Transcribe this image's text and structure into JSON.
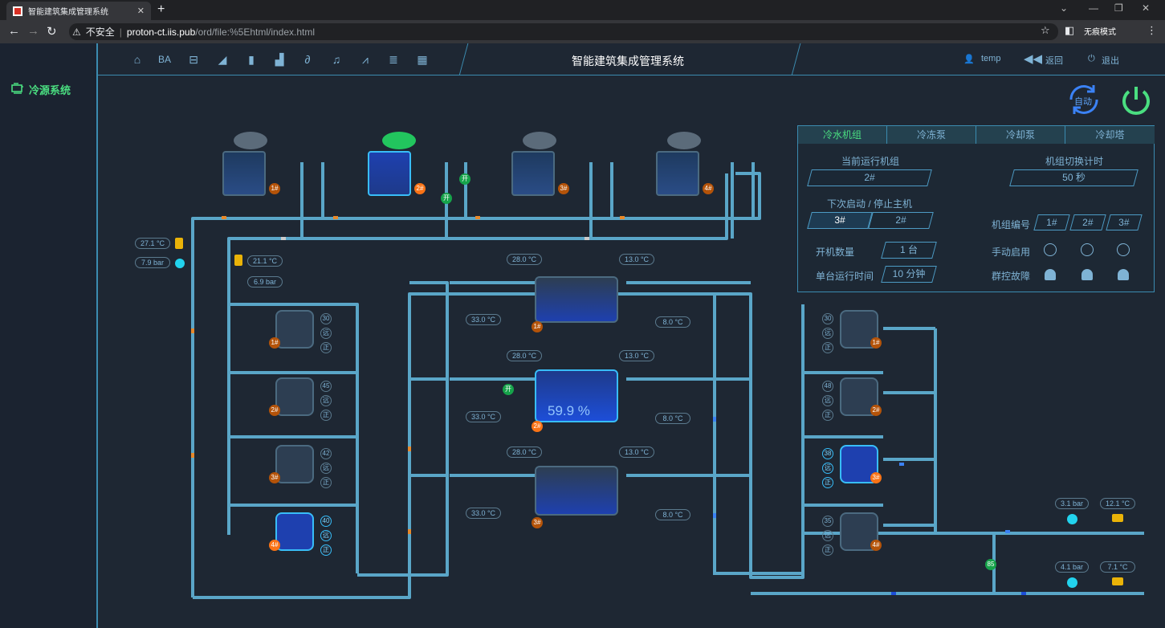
{
  "browser": {
    "tab_title": "智能建筑集成管理系统",
    "new_tab": "+",
    "security": "不安全",
    "url_host": "proton-ct.iis.pub",
    "url_path": "/ord/file:%5Ehtml/index.html",
    "incognito": "无痕模式"
  },
  "sidebar": {
    "items": [
      {
        "label": "冷源系统",
        "icon": "chiller-icon"
      }
    ]
  },
  "header": {
    "title": "智能建筑集成管理系统",
    "user": "temp",
    "back": "返回",
    "logout": "退出",
    "nav_icons": [
      "home-icon",
      "ba-icon",
      "chiller-icon",
      "dish-icon",
      "panel-icon",
      "chart-bar-icon",
      "clip-icon",
      "bell-icon",
      "trend-icon",
      "doc-icon",
      "grid-icon"
    ]
  },
  "controls": {
    "auto": "自动"
  },
  "panel": {
    "tabs": [
      "冷水机组",
      "冷冻泵",
      "冷却泵",
      "冷却塔"
    ],
    "current_unit_label": "当前运行机组",
    "current_unit": "2#",
    "switch_timer_label": "机组切换计时",
    "switch_timer": "50 秒",
    "next_label": "下次启动 / 停止主机",
    "next_start": "3#",
    "next_stop": "2#",
    "unit_no_label": "机组编号",
    "units": [
      "1#",
      "2#",
      "3#"
    ],
    "count_label": "开机数量",
    "count": "1 台",
    "manual_label": "手动启用",
    "runtime_label": "单台运行时间",
    "runtime": "10 分钟",
    "fault_label": "群控故障"
  },
  "towers": [
    {
      "id": "1#",
      "active": false
    },
    {
      "id": "2#",
      "active": true,
      "valve1": "开",
      "valve2": "开"
    },
    {
      "id": "3#",
      "active": false
    },
    {
      "id": "4#",
      "active": false
    }
  ],
  "sensors": {
    "left_temp": "27.1 °C",
    "left_press": "7.9 bar",
    "left2_temp": "21.1 °C",
    "left2_press": "6.9 bar",
    "right1_press": "3.1 bar",
    "right1_temp": "12.1 °C",
    "right2_press": "4.1 bar",
    "right2_temp": "7.1 °C"
  },
  "chillers": [
    {
      "id": "1#",
      "t_in_left": "28.0 °C",
      "t_out_left": "33.0 °C",
      "t_in_right": "13.0 °C",
      "t_out_right": "8.0 °C",
      "active": false
    },
    {
      "id": "2#",
      "t_in_left": "28.0 °C",
      "t_out_left": "33.0 °C",
      "t_in_right": "13.0 °C",
      "t_out_right": "8.0 °C",
      "active": true,
      "load": "59.9 %",
      "valve": "开"
    },
    {
      "id": "3#",
      "t_in_left": "28.0 °C",
      "t_out_left": "33.0 °C",
      "t_in_right": "13.0 °C",
      "t_out_right": "8.0 °C",
      "active": false
    }
  ],
  "left_pumps": [
    {
      "id": "1#",
      "freq": "30",
      "mode": "远",
      "state": "正",
      "active": false
    },
    {
      "id": "2#",
      "freq": "45",
      "mode": "远",
      "state": "正",
      "active": false
    },
    {
      "id": "3#",
      "freq": "42",
      "mode": "远",
      "state": "正",
      "active": false
    },
    {
      "id": "4#",
      "freq": "40",
      "mode": "远",
      "state": "正",
      "active": true
    }
  ],
  "right_pumps": [
    {
      "id": "1#",
      "freq": "30",
      "mode": "远",
      "state": "正",
      "active": false
    },
    {
      "id": "2#",
      "freq": "48",
      "mode": "远",
      "state": "正",
      "active": false
    },
    {
      "id": "3#",
      "freq": "38",
      "mode": "远",
      "state": "正",
      "active": true
    },
    {
      "id": "4#",
      "freq": "35",
      "mode": "远",
      "state": "正",
      "active": false
    }
  ],
  "bypass_valve": "85",
  "colors": {
    "accent": "#3b8bb0",
    "active": "#4ade80",
    "pipe": "#5aa6c8",
    "orange": "#e8892b"
  }
}
